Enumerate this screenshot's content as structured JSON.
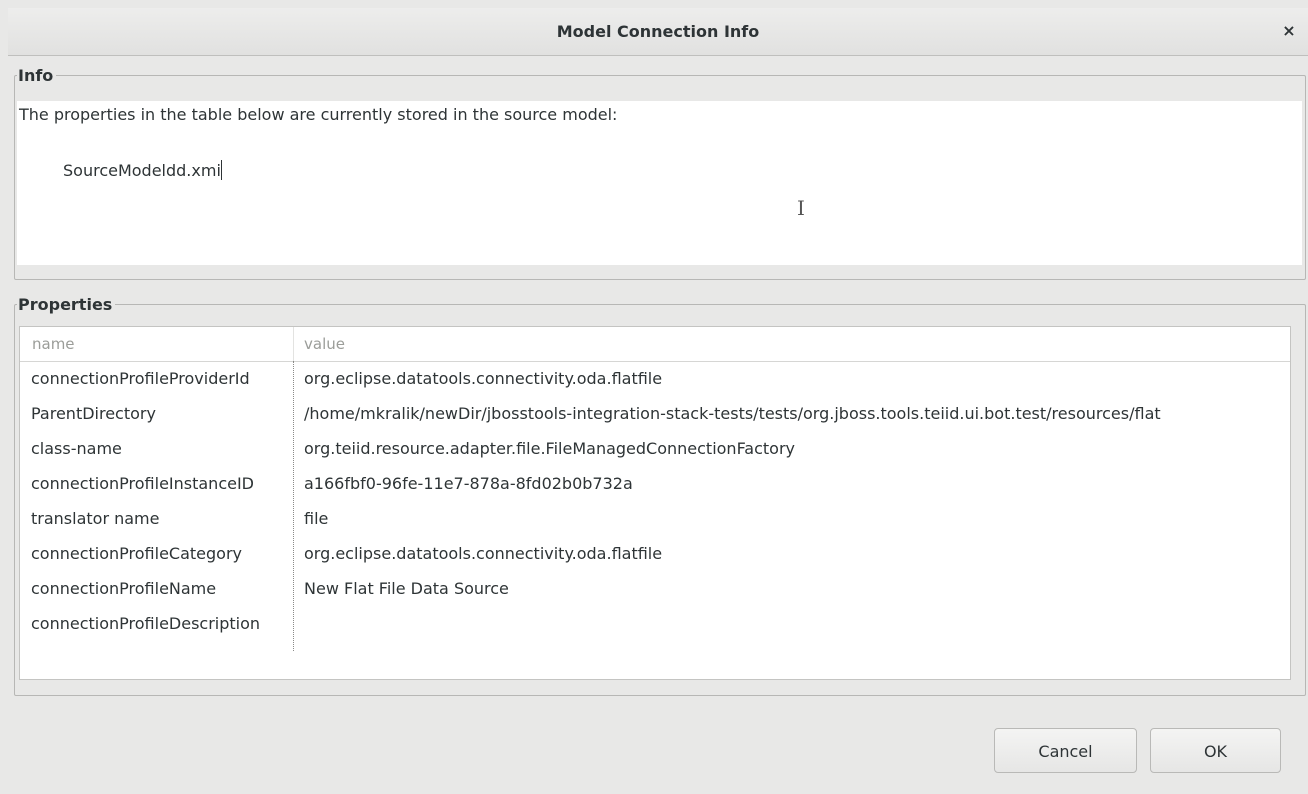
{
  "dialog": {
    "title": "Model Connection Info",
    "close_label": "×"
  },
  "info": {
    "group_label": "Info",
    "description": "The properties in the table below are currently stored in the source model:",
    "model_file": "SourceModeldd.xmi"
  },
  "properties": {
    "group_label": "Properties",
    "columns": [
      "name",
      "value"
    ],
    "rows": [
      {
        "name": "connectionProfileProviderId",
        "value": "org.eclipse.datatools.connectivity.oda.flatfile"
      },
      {
        "name": "ParentDirectory",
        "value": "/home/mkralik/newDir/jbosstools-integration-stack-tests/tests/org.jboss.tools.teiid.ui.bot.test/resources/flat"
      },
      {
        "name": "class-name",
        "value": "org.teiid.resource.adapter.file.FileManagedConnectionFactory"
      },
      {
        "name": "connectionProfileInstanceID",
        "value": "a166fbf0-96fe-11e7-878a-8fd02b0b732a"
      },
      {
        "name": "translator name",
        "value": "file"
      },
      {
        "name": "connectionProfileCategory",
        "value": "org.eclipse.datatools.connectivity.oda.flatfile"
      },
      {
        "name": "connectionProfileName",
        "value": "New Flat File Data Source"
      },
      {
        "name": "connectionProfileDescription",
        "value": ""
      }
    ]
  },
  "buttons": {
    "cancel_label": "Cancel",
    "ok_label": "OK"
  }
}
